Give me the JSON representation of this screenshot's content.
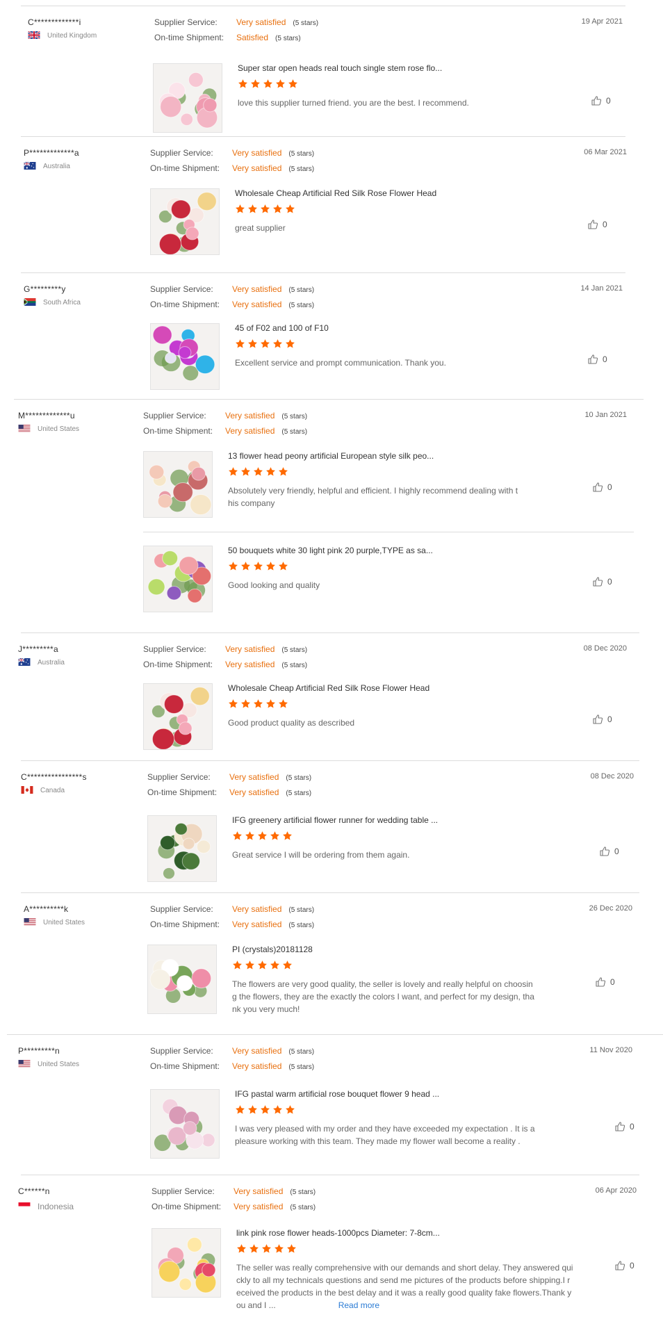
{
  "labels": {
    "supplier_service": "Supplier Service:",
    "ontime_shipment": "On-time Shipment:",
    "read_more": "Read more"
  },
  "colors": {
    "accent": "#e8700f",
    "star": "#ff6a00",
    "link": "#2a7bd4"
  },
  "reviews": [
    {
      "buyer": "C*************i",
      "country": "United Kingdom",
      "flag": "uk-flag",
      "date": "19 Apr 2021",
      "supplier_service": "Very satisfied",
      "supplier_stars": "(5 stars)",
      "shipment": "Satisfied",
      "shipment_stars": "(5 stars)",
      "products": [
        {
          "title": "Super star open heads real touch single stem rose flo...",
          "stars": 5,
          "comment": [
            "love this supplier turned friend. you are the best. I recommend."
          ],
          "likes": "0",
          "image": "rose-bouquet-pink"
        }
      ]
    },
    {
      "buyer": "P*************a",
      "country": "Australia",
      "flag": "au-flag",
      "date": "06 Mar 2021",
      "supplier_service": "Very satisfied",
      "supplier_stars": "(5 stars)",
      "shipment": "Very satisfied",
      "shipment_stars": "(5 stars)",
      "products": [
        {
          "title": "Wholesale Cheap Artificial Red Silk Rose Flower Head",
          "stars": 5,
          "comment": [
            "great supplier"
          ],
          "likes": "0",
          "image": "rose-heads-mixed"
        }
      ]
    },
    {
      "buyer": "G*********y",
      "country": "South Africa",
      "flag": "za-flag",
      "date": "14 Jan 2021",
      "supplier_service": "Very satisfied",
      "supplier_stars": "(5 stars)",
      "shipment": "Very satisfied",
      "shipment_stars": "(5 stars)",
      "products": [
        {
          "title": "45 of F02 and 100 of F10",
          "stars": 5,
          "comment": [
            "Excellent service and prompt communication. Thank you."
          ],
          "likes": "0",
          "image": "orchid-stems"
        }
      ]
    },
    {
      "buyer": "M*************u",
      "country": "United States",
      "flag": "us-flag",
      "date": "10 Jan 2021",
      "supplier_service": "Very satisfied",
      "supplier_stars": "(5 stars)",
      "shipment": "Very satisfied",
      "shipment_stars": "(5 stars)",
      "products": [
        {
          "title": "13 flower head peony artificial European style silk peo...",
          "stars": 5,
          "comment": [
            "Absolutely very friendly, helpful and efficient. I highly recommend dealing with t",
            "his company"
          ],
          "likes": "0",
          "image": "peony-bunches"
        },
        {
          "title": "50 bouquets white 30 light pink 20 purple,TYPE as sa...",
          "stars": 5,
          "comment": [
            "Good looking and quality"
          ],
          "likes": "0",
          "image": "rose-bouquets-colors"
        }
      ]
    },
    {
      "buyer": "J*********a",
      "country": "Australia",
      "flag": "au-flag",
      "date": "08 Dec 2020",
      "supplier_service": "Very satisfied",
      "supplier_stars": "(5 stars)",
      "shipment": "Very satisfied",
      "shipment_stars": "(5 stars)",
      "products": [
        {
          "title": "Wholesale Cheap Artificial Red Silk Rose Flower Head",
          "stars": 5,
          "comment": [
            "Good product quality as described"
          ],
          "likes": "0",
          "image": "rose-heads-mixed"
        }
      ]
    },
    {
      "buyer": "C****************s",
      "country": "Canada",
      "flag": "ca-flag",
      "date": "08 Dec 2020",
      "supplier_service": "Very satisfied",
      "supplier_stars": "(5 stars)",
      "shipment": "Very satisfied",
      "shipment_stars": "(5 stars)",
      "products": [
        {
          "title": "IFG greenery artificial flower runner for wedding table ...",
          "stars": 5,
          "comment": [
            "Great service I will be ordering from them again."
          ],
          "likes": "0",
          "image": "greenery-runner"
        }
      ]
    },
    {
      "buyer": "A**********k",
      "country": "United States",
      "flag": "us-flag",
      "date": "26 Dec 2020",
      "supplier_service": "Very satisfied",
      "supplier_stars": "(5 stars)",
      "shipment": "Very satisfied",
      "shipment_stars": "(5 stars)",
      "products": [
        {
          "title": "PI (crystals)20181128",
          "stars": 5,
          "comment": [
            "The flowers are very good quality, the seller is lovely and really helpful on choosin",
            "g the flowers, they are the exactly the colors I want, and perfect for my design, tha",
            "nk you very much!"
          ],
          "likes": "0",
          "image": "lily-vases"
        }
      ]
    },
    {
      "buyer": "P*********n",
      "country": "United States",
      "flag": "us-flag",
      "date": "11 Nov 2020",
      "supplier_service": "Very satisfied",
      "supplier_stars": "(5 stars)",
      "shipment": "Very satisfied",
      "shipment_stars": "(5 stars)",
      "products": [
        {
          "title": "IFG pastal warm artificial rose bouquet flower 9 head ...",
          "stars": 5,
          "comment": [
            "I was very pleased with my order and they have exceeded my expectation . It is a",
            "pleasure working with this team. They made my flower wall become a reality ."
          ],
          "likes": "0",
          "image": "pastel-rose-bouquet"
        }
      ]
    },
    {
      "buyer": "C******n",
      "country": "Indonesia",
      "flag": "id-flag",
      "date": "06 Apr 2020",
      "supplier_service": "Very satisfied",
      "supplier_stars": "(5 stars)",
      "shipment": "Very satisfied",
      "shipment_stars": "(5 stars)",
      "products": [
        {
          "title": "link pink rose flower heads-1000pcs Diameter: 7-8cm...",
          "stars": 5,
          "comment": [
            "The seller was really comprehensive with our demands and short delay. They answered qui",
            "ckly to all my technicals questions and send me pictures of the products before shipping.I r",
            "eceived the products in the best delay and it was a really good quality fake flowers.Thank y",
            "ou and I ..."
          ],
          "likes": "0",
          "image": "rose-heads-colors",
          "read_more": true
        }
      ]
    }
  ]
}
